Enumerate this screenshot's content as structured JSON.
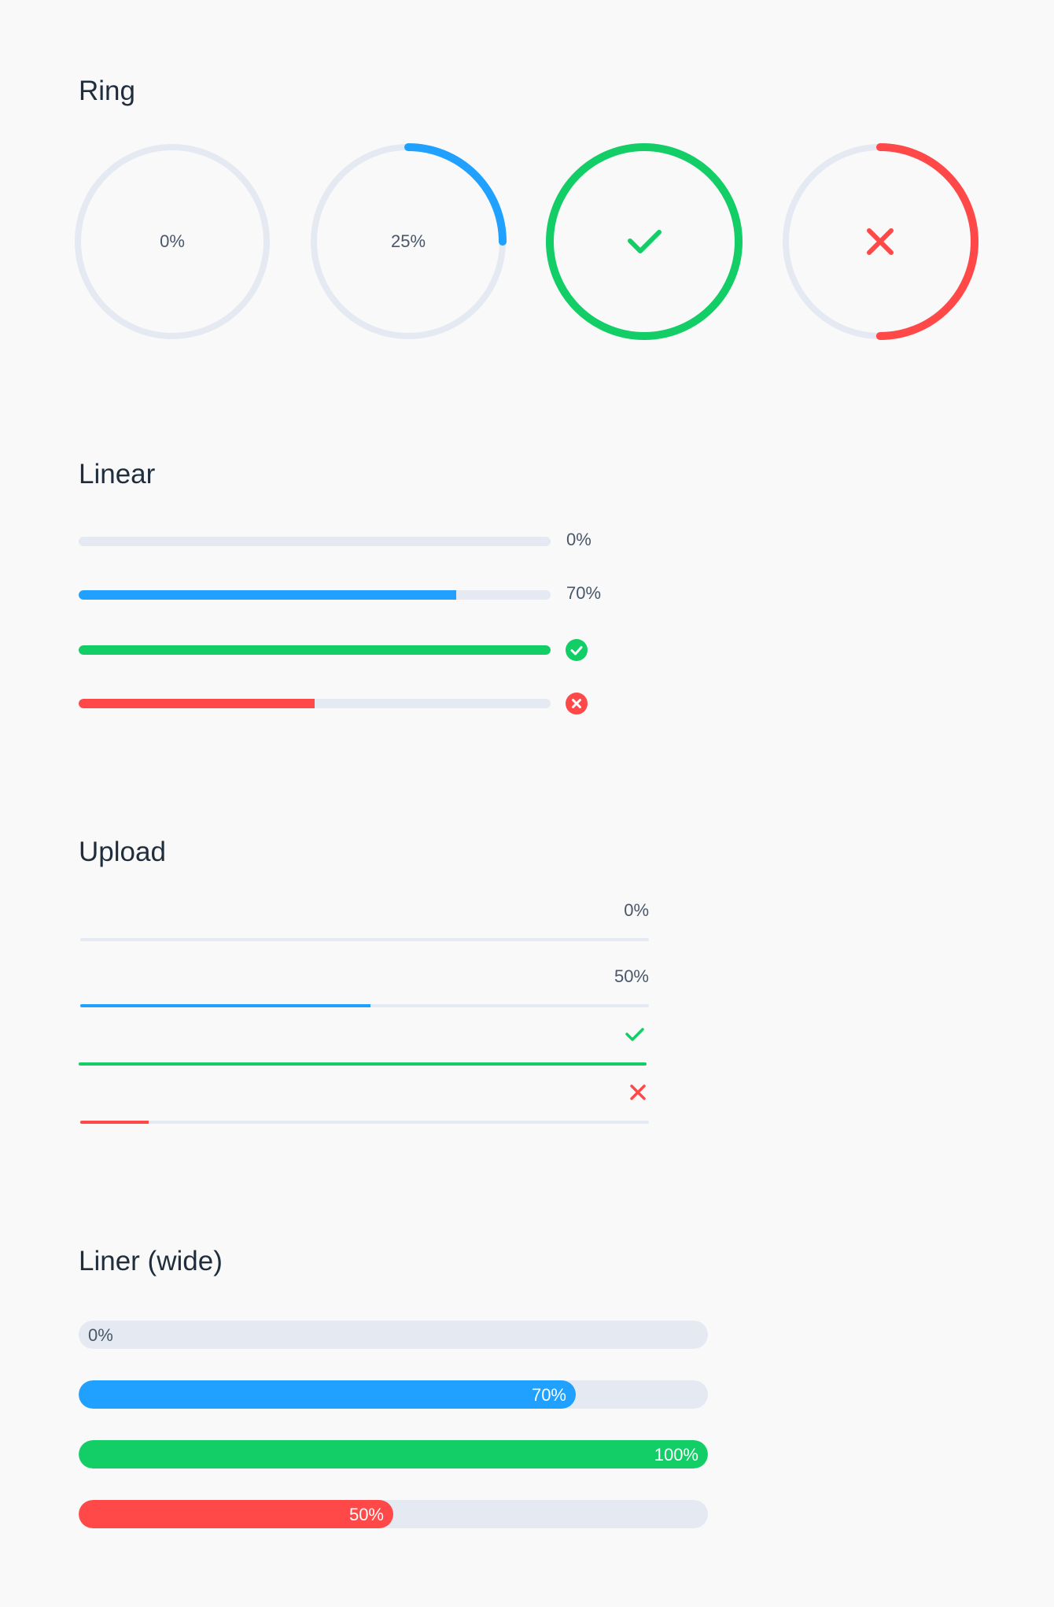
{
  "colors": {
    "track": "#e5e9f2",
    "primary": "#20a0ff",
    "success": "#13ce66",
    "danger": "#ff4949",
    "text": "#48576a"
  },
  "ring": {
    "title": "Ring",
    "items": [
      {
        "status": "normal",
        "label": "0%",
        "progress": 0
      },
      {
        "status": "normal",
        "label": "25%",
        "progress": 0.25
      },
      {
        "status": "success",
        "icon": "check-icon",
        "progress": 1.0
      },
      {
        "status": "exception",
        "icon": "close-icon",
        "progress": 0.5
      }
    ]
  },
  "linear": {
    "title": "Linear",
    "items": [
      {
        "status": "normal",
        "label": "0%",
        "progress": 0
      },
      {
        "status": "normal",
        "label": "70%",
        "progress": 0.8
      },
      {
        "status": "success",
        "icon": "check-circle-icon",
        "progress": 1.0
      },
      {
        "status": "exception",
        "icon": "close-circle-icon",
        "progress": 0.5
      }
    ]
  },
  "upload": {
    "title": "Upload",
    "items": [
      {
        "status": "normal",
        "label": "0%",
        "progress": 0
      },
      {
        "status": "normal",
        "label": "50%",
        "progress": 0.51
      },
      {
        "status": "success",
        "icon": "check-icon",
        "progress": 1.0
      },
      {
        "status": "exception",
        "icon": "close-icon",
        "progress": 0.12
      }
    ]
  },
  "wide": {
    "title": "Liner (wide)",
    "items": [
      {
        "status": "normal",
        "label": "0%",
        "progress": 0
      },
      {
        "status": "normal",
        "label": "70%",
        "progress": 0.79
      },
      {
        "status": "success",
        "label": "100%",
        "progress": 1.0
      },
      {
        "status": "exception",
        "label": "50%",
        "progress": 0.5
      }
    ]
  }
}
